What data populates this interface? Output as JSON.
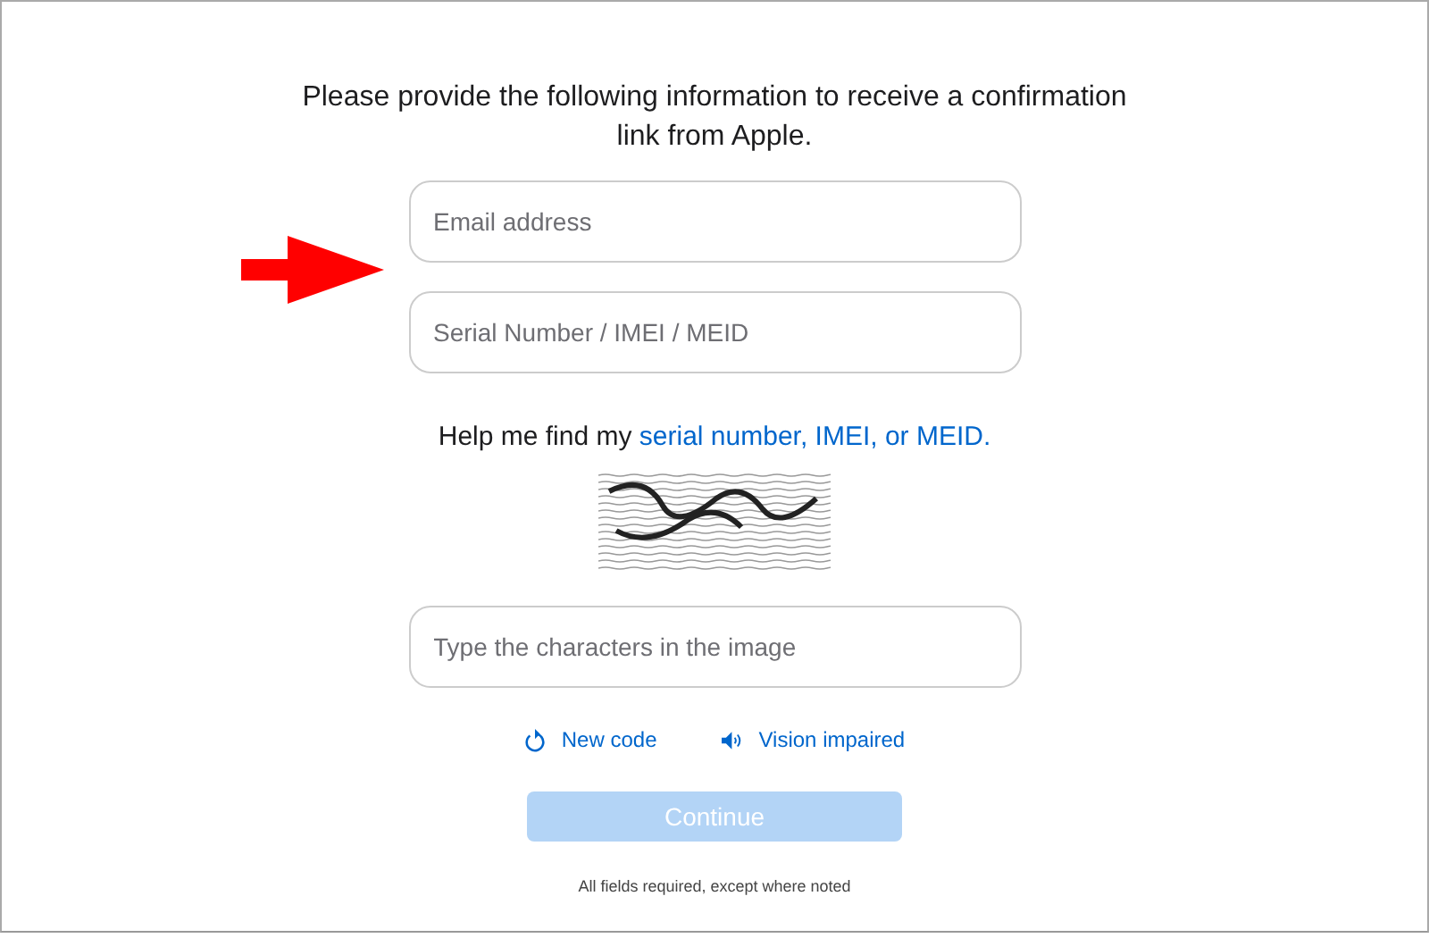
{
  "intro": "Please provide the following information to receive a confirmation link from Apple.",
  "fields": [
    {
      "placeholder": "Email address"
    },
    {
      "placeholder": "Serial Number / IMEI / MEID"
    }
  ],
  "help": {
    "text": "Help me find my",
    "link": "serial number, IMEI, or MEID."
  },
  "captcha_field": {
    "placeholder": "Type the characters in the image"
  },
  "links": [
    {
      "kind": "refresh",
      "label": "New code"
    },
    {
      "kind": "audio",
      "label": "Vision impaired"
    }
  ],
  "continue": {
    "label": "Continue",
    "disabled": true
  },
  "footer": "All fields required, except where noted"
}
